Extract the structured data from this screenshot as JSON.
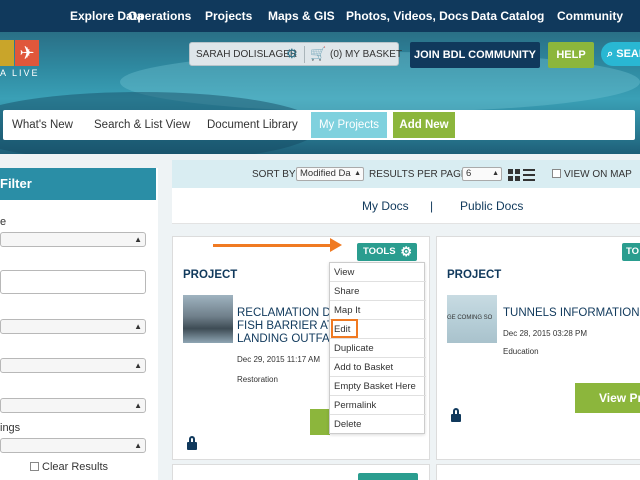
{
  "top_nav": {
    "items": [
      "Explore Data",
      "Operations",
      "Projects",
      "Maps & GIS",
      "Photos, Videos, Docs",
      "Data Catalog",
      "Community"
    ]
  },
  "header": {
    "logo_text": "A LIVE",
    "user_name": "SARAH DOLISLAGER",
    "basket_label": "(0) MY BASKET",
    "join_label": "JOIN BDL COMMUNITY",
    "help_label": "HELP",
    "search_label": "SEAR",
    "icons": {
      "settings": "gear-icon",
      "cart": "cart-icon",
      "search": "search-icon"
    }
  },
  "sub_nav": {
    "items": [
      "What's New",
      "Search & List View",
      "Document Library"
    ],
    "active": "My Projects",
    "add_new": "Add New"
  },
  "filter": {
    "title": "Filter",
    "labels": [
      "e",
      "ings"
    ],
    "clear_label": "Clear Results"
  },
  "results_bar": {
    "sort_by_label": "SORT BY",
    "sort_value": "Modified Da",
    "per_page_label": "RESULTS PER PAGE",
    "per_page_value": "6",
    "view_on_map_label": "VIEW ON MAP"
  },
  "docs_tabs": {
    "my_docs": "My Docs",
    "separator": "|",
    "public_docs": "Public Docs"
  },
  "cards": [
    {
      "type": "PROJECT",
      "title_lines": [
        "RECLAMATION D",
        "FISH BARRIER AT",
        "LANDING OUTFA"
      ],
      "date": "Dec 29, 2015 11:17 AM",
      "category": "Restoration",
      "tools_label": "TOOLS"
    },
    {
      "type": "PROJECT",
      "title_lines": [
        "TUNNELS INFORMATION M"
      ],
      "thumb_text": "GE COMING SO",
      "date": "Dec 28, 2015 03:28 PM",
      "category": "Education",
      "view_label": "View Pro",
      "tools_label": "TO"
    }
  ],
  "tools_menu": {
    "items": [
      "View",
      "Share",
      "Map It",
      "Edit",
      "Duplicate",
      "Add to Basket",
      "Empty Basket Here",
      "Permalink",
      "Delete"
    ],
    "highlighted": "Edit"
  },
  "colors": {
    "nav": "#10395c",
    "accent_green": "#8cb63c",
    "accent_teal": "#2a9d8f",
    "annotation_orange": "#f07a22",
    "filter_header": "#2a8ea6"
  }
}
